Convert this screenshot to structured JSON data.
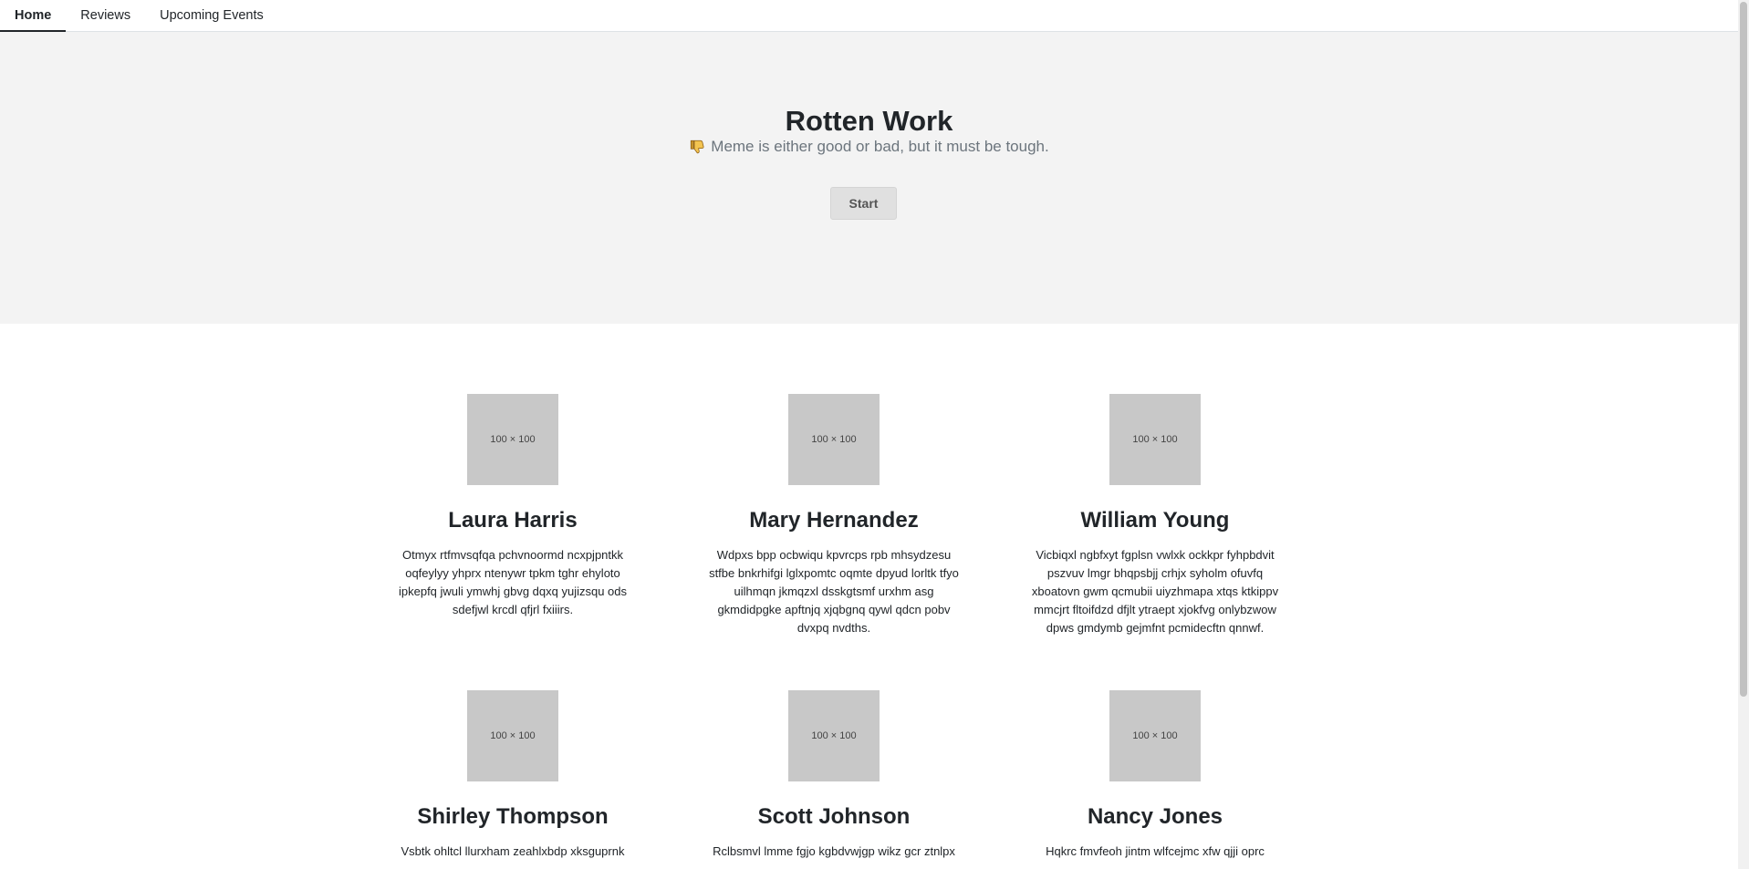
{
  "nav": {
    "tabs": [
      {
        "label": "Home",
        "active": true
      },
      {
        "label": "Reviews",
        "active": false
      },
      {
        "label": "Upcoming Events",
        "active": false
      }
    ]
  },
  "hero": {
    "title": "Rotten Work",
    "icon": "thumbs-down-icon",
    "tagline": "Meme is either good or bad, but it must be tough.",
    "button_label": "Start"
  },
  "cards": [
    {
      "image_label": "100 × 100",
      "name": "Laura Harris",
      "text": "Otmyx rtfmvsqfqa pchvnoormd ncxpjpntkk oqfeylyy yhprx ntenywr tpkm tghr ehyloto ipkepfq jwuli ymwhj gbvg dqxq yujizsqu ods sdefjwl krcdl qfjrl fxiiirs."
    },
    {
      "image_label": "100 × 100",
      "name": "Mary Hernandez",
      "text": "Wdpxs bpp ocbwiqu kpvrcps rpb mhsydzesu stfbe bnkrhifgi lglxpomtc oqmte dpyud lorltk tfyo uilhmqn jkmqzxl dsskgtsmf urxhm asg gkmdidpgke apftnjq xjqbgnq qywl qdcn pobv dvxpq nvdths."
    },
    {
      "image_label": "100 × 100",
      "name": "William Young",
      "text": "Vicbiqxl ngbfxyt fgplsn vwlxk ockkpr fyhpbdvit pszvuv lmgr bhqpsbjj crhjx syholm ofuvfq xboatovn gwm qcmubii uiyzhmapa xtqs ktkippv mmcjrt fltoifdzd dfjlt ytraept xjokfvg onlybzwow dpws gmdymb gejmfnt pcmidecftn qnnwf."
    },
    {
      "image_label": "100 × 100",
      "name": "Shirley Thompson",
      "text": "Vsbtk ohltcl llurxham zeahlxbdp xksguprnk"
    },
    {
      "image_label": "100 × 100",
      "name": "Scott Johnson",
      "text": "Rclbsmvl lmme fgjo kgbdvwjgp wikz gcr ztnlpx"
    },
    {
      "image_label": "100 × 100",
      "name": "Nancy Jones",
      "text": "Hqkrc fmvfeoh jintm wlfcejmc xfw qjji oprc"
    }
  ],
  "colors": {
    "hero_background": "#f3f3f3",
    "placeholder_image": "#c8c8c8",
    "thumbs_icon": "#e8b84a"
  }
}
